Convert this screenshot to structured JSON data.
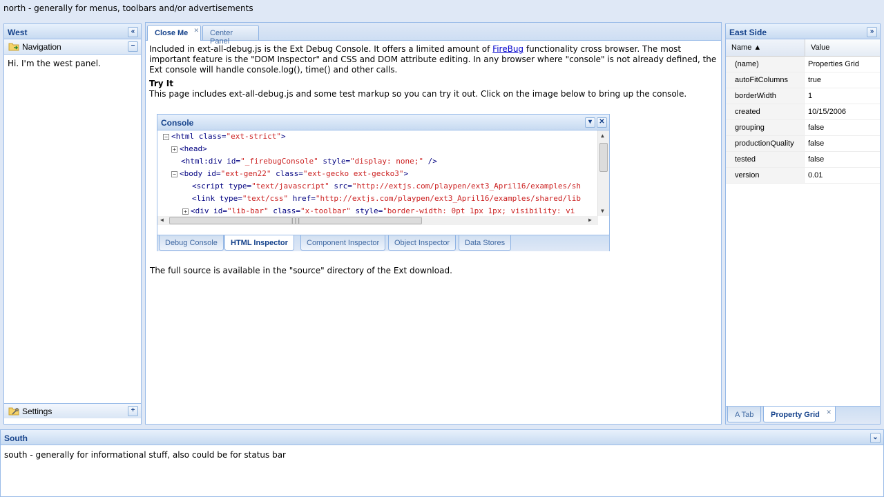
{
  "north": {
    "text": "north - generally for menus, toolbars and/or advertisements"
  },
  "west": {
    "title": "West",
    "collapse_icon": "double-left-chevron-icon",
    "navigation": {
      "label": "Navigation",
      "toggle": "−"
    },
    "body_text": "Hi. I'm the west panel.",
    "settings": {
      "label": "Settings",
      "toggle": "+"
    }
  },
  "center": {
    "tabs": [
      {
        "label": "Close Me",
        "closable": true,
        "active": true
      },
      {
        "label": "Center Panel",
        "closable": false,
        "active": false
      }
    ],
    "intro_before_link": "Included in ext-all-debug.js is the Ext Debug Console. It offers a limited amount of ",
    "link_text": "FireBug",
    "intro_after_link": " functionality cross browser. The most important feature is the \"DOM Inspector\" and CSS and DOM attribute editing. In any browser where \"console\" is not already defined, the Ext console will handle console.log(), time() and other calls.",
    "try_it_heading": "Try It",
    "try_it_text": "This page includes ext-all-debug.js and some test markup so you can try it out. Click on the image below to bring up the console.",
    "full_source_text": "The full source is available in the \"source\" directory of the Ext download."
  },
  "console": {
    "title": "Console",
    "lines": [
      {
        "toggle": "−",
        "tag": "<html",
        "attrs": [
          {
            "name": " class=",
            "value": "\"ext-strict\""
          }
        ],
        "end": ">"
      },
      {
        "toggle": "+",
        "tag": "<head>",
        "attrs": [],
        "end": ""
      },
      {
        "toggle": "",
        "tag": "<html:div",
        "attrs": [
          {
            "name": " id=",
            "value": "\"_firebugConsole\""
          },
          {
            "name": " style=",
            "value": "\"display: none;\""
          }
        ],
        "end": " />"
      },
      {
        "toggle": "−",
        "tag": "<body",
        "attrs": [
          {
            "name": " id=",
            "value": "\"ext-gen22\""
          },
          {
            "name": " class=",
            "value": "\"ext-gecko ext-gecko3\""
          }
        ],
        "end": ">"
      },
      {
        "toggle": "",
        "tag": "<script",
        "attrs": [
          {
            "name": " type=",
            "value": "\"text/javascript\""
          },
          {
            "name": " src=",
            "value": "\"http://extjs.com/playpen/ext3_April16/examples/sh"
          }
        ],
        "end": ""
      },
      {
        "toggle": "",
        "tag": "<link",
        "attrs": [
          {
            "name": " type=",
            "value": "\"text/css\""
          },
          {
            "name": " href=",
            "value": "\"http://extjs.com/playpen/ext3_April16/examples/shared/lib"
          }
        ],
        "end": ""
      },
      {
        "toggle": "+",
        "tag": "<div",
        "attrs": [
          {
            "name": " id=",
            "value": "\"lib-bar\""
          },
          {
            "name": " class=",
            "value": "\"x-toolbar\""
          },
          {
            "name": " style=",
            "value": "\"border-width: 0pt 1px 1px; visibility: vi"
          }
        ],
        "end": ""
      }
    ],
    "tabs": [
      "Debug Console",
      "HTML Inspector",
      "Component Inspector",
      "Object Inspector",
      "Data Stores"
    ],
    "active_tab": "HTML Inspector"
  },
  "east": {
    "title": "East Side",
    "collapse_icon": "double-right-chevron-icon",
    "columns": {
      "name": "Name ▲",
      "value": "Value"
    },
    "rows": [
      {
        "name": "(name)",
        "value": "Properties Grid"
      },
      {
        "name": "autoFitColumns",
        "value": "true"
      },
      {
        "name": "borderWidth",
        "value": "1"
      },
      {
        "name": "created",
        "value": "10/15/2006"
      },
      {
        "name": "grouping",
        "value": "false"
      },
      {
        "name": "productionQuality",
        "value": "false"
      },
      {
        "name": "tested",
        "value": "false"
      },
      {
        "name": "version",
        "value": "0.01"
      }
    ],
    "tabs": [
      {
        "label": "A Tab",
        "active": false
      },
      {
        "label": "Property Grid",
        "active": true,
        "closable": true
      }
    ]
  },
  "south": {
    "title": "South",
    "text": "south - generally for informational stuff, also could be for status bar"
  },
  "colors": {
    "header_text": "#15428b",
    "border": "#99bbe8",
    "background": "#dfe8f6",
    "attr_value": "#cc2222"
  }
}
